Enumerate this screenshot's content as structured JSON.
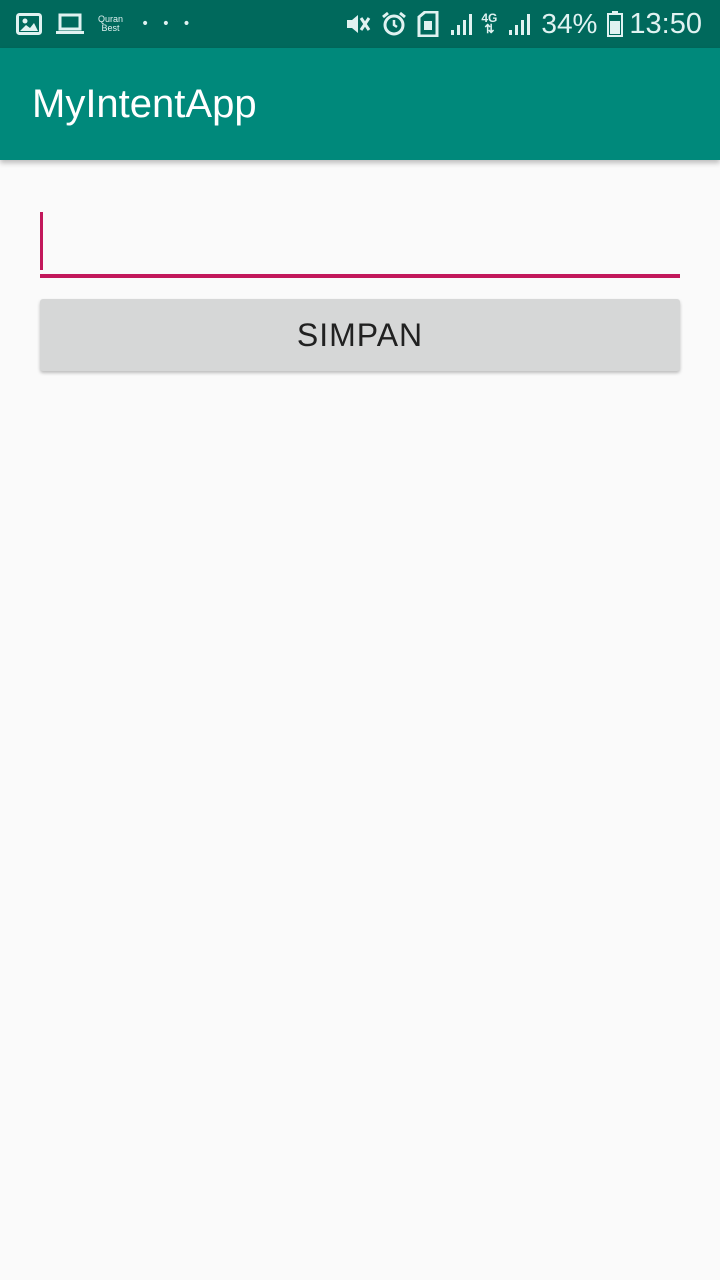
{
  "status_bar": {
    "left_icons": [
      "image-icon",
      "laptop-icon"
    ],
    "quran_label_line1": "Quran",
    "quran_label_line2": "Best",
    "more_dots": "• • •",
    "right_icons": [
      "vibrate-mute-icon",
      "alarm-icon",
      "sim-icon",
      "signal-icon"
    ],
    "network": "4G",
    "battery_percent": "34%",
    "time": "13:50"
  },
  "app_bar": {
    "title": "MyIntentApp",
    "background": "#00897b",
    "status_background": "#00695c"
  },
  "form": {
    "text_value": "",
    "accent_color": "#c2185b",
    "save_button_label": "SIMPAN"
  }
}
